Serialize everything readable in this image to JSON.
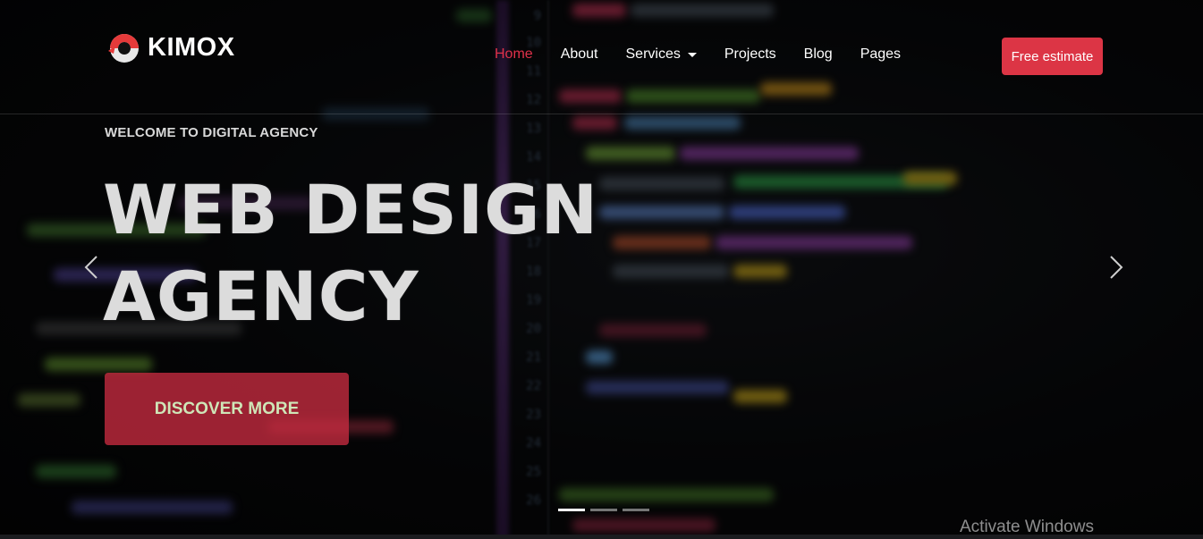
{
  "brand": {
    "name": "KIMOX",
    "accent": "#dc3545",
    "nav_active_color": "#e0314a"
  },
  "nav": {
    "items": [
      {
        "label": "Home",
        "active": true
      },
      {
        "label": "About",
        "active": false
      },
      {
        "label": "Services",
        "active": false,
        "dropdown": true
      },
      {
        "label": "Projects",
        "active": false
      },
      {
        "label": "Blog",
        "active": false
      },
      {
        "label": "Pages",
        "active": false
      }
    ],
    "cta_label": "Free estimate"
  },
  "hero": {
    "eyebrow": "WELCOME TO DIGITAL AGENCY",
    "title_line1": "WEB DESIGN",
    "title_line2": "AGENCY",
    "button_label": "DISCOVER MORE",
    "prev_icon": "chevron-left-icon",
    "next_icon": "chevron-right-icon",
    "slides_total": 3,
    "slide_active": 1
  },
  "overlay_text": {
    "watermark": "Activate Windows"
  }
}
